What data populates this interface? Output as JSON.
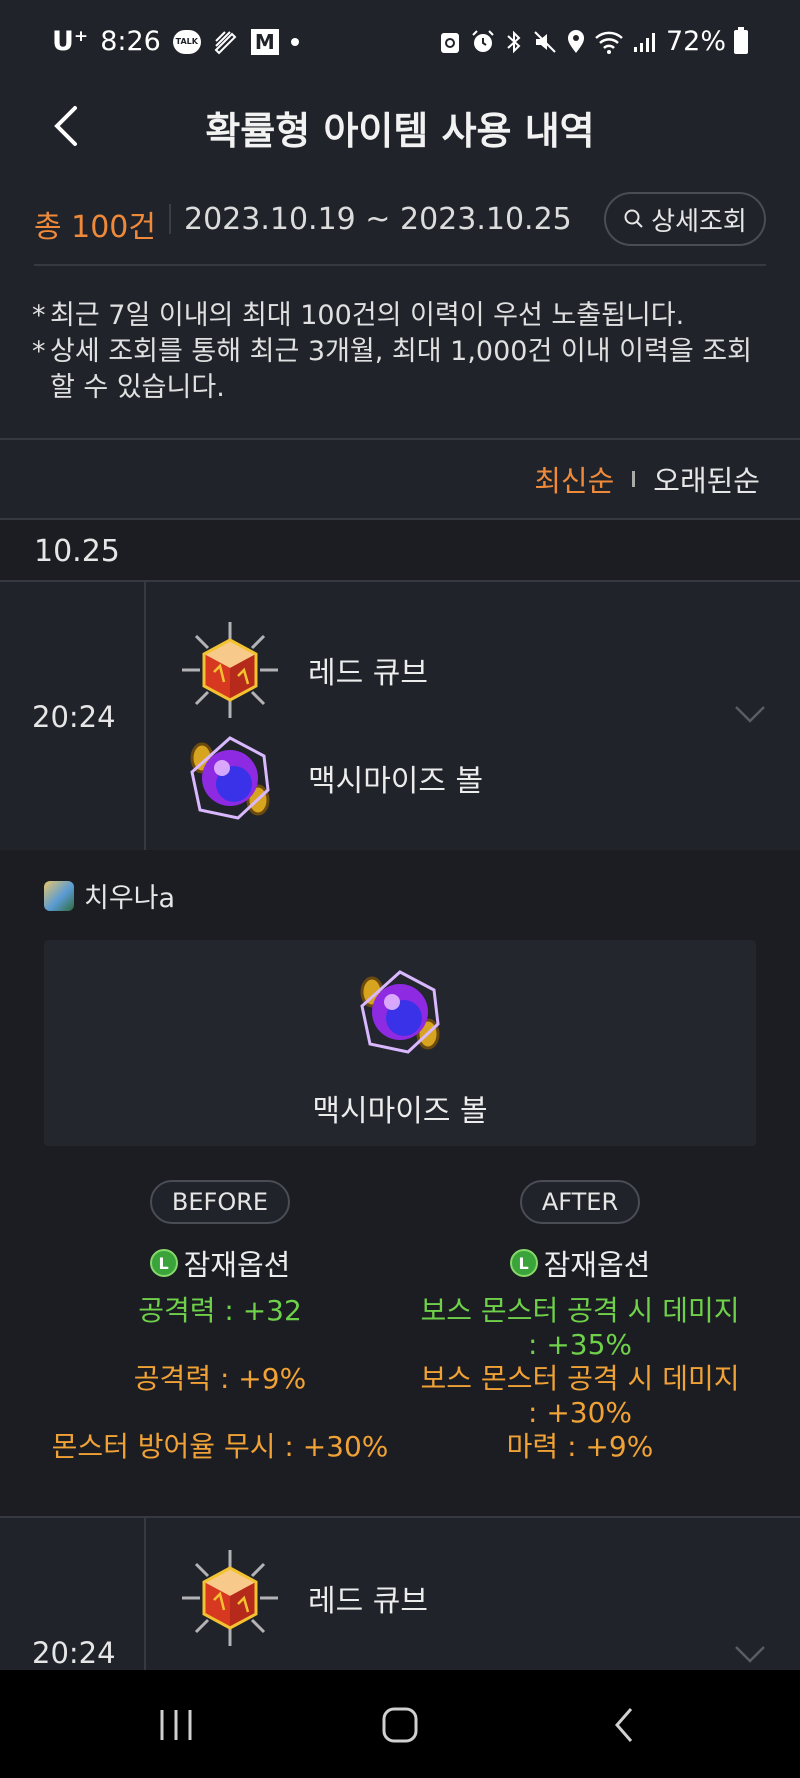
{
  "status_bar": {
    "carrier": "U⁺",
    "time": "8:26",
    "talk_label": "TALK",
    "gmail_label": "M",
    "battery": "72%"
  },
  "header": {
    "title": "확률형 아이템 사용 내역"
  },
  "summary": {
    "total": "총 100건",
    "range": "2023.10.19 ~ 2023.10.25",
    "detail_button": "상세조회"
  },
  "notes": [
    "최근 7일 이내의 최대 100건의 이력이 우선 노출됩니다.",
    "상세 조회를 통해 최근 3개월, 최대 1,000건 이내 이력을 조회 할 수 있습니다."
  ],
  "sort": {
    "newest": "최신순",
    "oldest": "오래된순"
  },
  "date_group": "10.25",
  "records": [
    {
      "time": "20:24",
      "cube": "레드 큐브",
      "target": "맥시마이즈 볼"
    },
    {
      "time": "20:24",
      "cube": "레드 큐브"
    }
  ],
  "detail": {
    "character": "치우나a",
    "item_name": "맥시마이즈 볼",
    "before_label": "BEFORE",
    "after_label": "AFTER",
    "potential_label": "잠재옵션",
    "potential_grade": "L",
    "before_options": [
      {
        "text": "공격력 : +32",
        "color": "green"
      },
      {
        "text": "공격력 : +9%",
        "color": "orange"
      },
      {
        "text": "몬스터 방어율 무시 : +30%",
        "color": "orange"
      }
    ],
    "after_options": [
      {
        "text": "보스 몬스터 공격 시 데미지 : +35%",
        "color": "green"
      },
      {
        "text": "보스 몬스터 공격 시 데미지 : +30%",
        "color": "orange"
      },
      {
        "text": "마력 : +9%",
        "color": "orange"
      }
    ]
  },
  "colors": {
    "accent": "#ee8a3a",
    "green": "#6fd14a",
    "orange": "#f0a236",
    "background": "#20232a"
  }
}
